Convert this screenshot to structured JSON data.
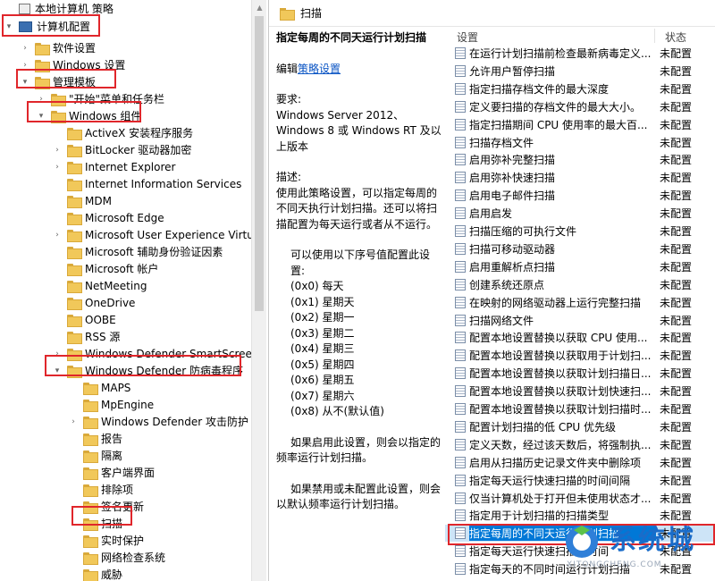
{
  "tree": {
    "nodes": [
      {
        "label": "本地计算机 策略",
        "toggle": "",
        "folder": false
      },
      {
        "label": "计算机配置",
        "toggle": "▾",
        "folder": false
      },
      {
        "label": "软件设置",
        "toggle": "›",
        "folder": true
      },
      {
        "label": "Windows 设置",
        "toggle": "›",
        "folder": true
      },
      {
        "label": "管理模板",
        "toggle": "▾",
        "folder": true
      },
      {
        "label": "\"开始\"菜单和任务栏",
        "toggle": "›",
        "folder": true
      },
      {
        "label": "Windows 组件",
        "toggle": "▾",
        "folder": true
      },
      {
        "label": "ActiveX 安装程序服务",
        "toggle": "",
        "folder": true
      },
      {
        "label": "BitLocker 驱动器加密",
        "toggle": "›",
        "folder": true
      },
      {
        "label": "Internet Explorer",
        "toggle": "›",
        "folder": true
      },
      {
        "label": "Internet Information Services",
        "toggle": "",
        "folder": true
      },
      {
        "label": "MDM",
        "toggle": "",
        "folder": true
      },
      {
        "label": "Microsoft Edge",
        "toggle": "",
        "folder": true
      },
      {
        "label": "Microsoft User Experience Virtuali",
        "toggle": "›",
        "folder": true
      },
      {
        "label": "Microsoft 辅助身份验证因素",
        "toggle": "",
        "folder": true
      },
      {
        "label": "Microsoft 帐户",
        "toggle": "",
        "folder": true
      },
      {
        "label": "NetMeeting",
        "toggle": "",
        "folder": true
      },
      {
        "label": "OneDrive",
        "toggle": "",
        "folder": true
      },
      {
        "label": "OOBE",
        "toggle": "",
        "folder": true
      },
      {
        "label": "RSS 源",
        "toggle": "",
        "folder": true
      },
      {
        "label": "Windows Defender SmartScreen",
        "toggle": "›",
        "folder": true
      },
      {
        "label": "Windows Defender 防病毒程序",
        "toggle": "▾",
        "folder": true
      },
      {
        "label": "MAPS",
        "toggle": "",
        "folder": true
      },
      {
        "label": "MpEngine",
        "toggle": "",
        "folder": true
      },
      {
        "label": "Windows Defender 攻击防护",
        "toggle": "›",
        "folder": true
      },
      {
        "label": "报告",
        "toggle": "",
        "folder": true
      },
      {
        "label": "隔离",
        "toggle": "",
        "folder": true
      },
      {
        "label": "客户端界面",
        "toggle": "",
        "folder": true
      },
      {
        "label": "排除项",
        "toggle": "",
        "folder": true
      },
      {
        "label": "签名更新",
        "toggle": "",
        "folder": true
      },
      {
        "label": "扫描",
        "toggle": "",
        "folder": true
      },
      {
        "label": "实时保护",
        "toggle": "",
        "folder": true
      },
      {
        "label": "网络检查系统",
        "toggle": "",
        "folder": true
      },
      {
        "label": "威胁",
        "toggle": "",
        "folder": true
      }
    ]
  },
  "right": {
    "title": "扫描",
    "desc": {
      "heading": "指定每周的不同天运行计划扫描",
      "edit_prefix": "编辑",
      "edit_link": "策略设置",
      "req_label": "要求:",
      "req_text": "Windows Server 2012、Windows 8 或 Windows RT 及以上版本",
      "desc_label": "描述:",
      "desc_text": "使用此策略设置，可以指定每周的不同天执行计划扫描。还可以将扫描配置为每天运行或者从不运行。",
      "values_intro": "可以使用以下序号值配置此设置:",
      "values": [
        "(0x0) 每天",
        "(0x1) 星期天",
        "(0x2) 星期一",
        "(0x3) 星期二",
        "(0x4) 星期三",
        "(0x5) 星期四",
        "(0x6) 星期五",
        "(0x7) 星期六",
        "(0x8) 从不(默认值)"
      ],
      "enabled_text": "如果启用此设置，则会以指定的频率运行计划扫描。",
      "disabled_text": "如果禁用或未配置此设置，则会以默认频率运行计划扫描。"
    },
    "columns": {
      "setting": "设置",
      "state": "状态"
    },
    "rows": [
      {
        "name": "在运行计划扫描前检查最新病毒定义...",
        "state": "未配置"
      },
      {
        "name": "允许用户暂停扫描",
        "state": "未配置"
      },
      {
        "name": "指定扫描存档文件的最大深度",
        "state": "未配置"
      },
      {
        "name": "定义要扫描的存档文件的最大大小。",
        "state": "未配置"
      },
      {
        "name": "指定扫描期间 CPU 使用率的最大百...",
        "state": "未配置"
      },
      {
        "name": "扫描存档文件",
        "state": "未配置"
      },
      {
        "name": "启用弥补完整扫描",
        "state": "未配置"
      },
      {
        "name": "启用弥补快速扫描",
        "state": "未配置"
      },
      {
        "name": "启用电子邮件扫描",
        "state": "未配置"
      },
      {
        "name": "启用启发",
        "state": "未配置"
      },
      {
        "name": "扫描压缩的可执行文件",
        "state": "未配置"
      },
      {
        "name": "扫描可移动驱动器",
        "state": "未配置"
      },
      {
        "name": "启用重解析点扫描",
        "state": "未配置"
      },
      {
        "name": "创建系统还原点",
        "state": "未配置"
      },
      {
        "name": "在映射的网络驱动器上运行完整扫描",
        "state": "未配置"
      },
      {
        "name": "扫描网络文件",
        "state": "未配置"
      },
      {
        "name": "配置本地设置替换以获取 CPU 使用...",
        "state": "未配置"
      },
      {
        "name": "配置本地设置替换以获取用于计划扫...",
        "state": "未配置"
      },
      {
        "name": "配置本地设置替换以获取计划扫描日...",
        "state": "未配置"
      },
      {
        "name": "配置本地设置替换以获取计划快速扫...",
        "state": "未配置"
      },
      {
        "name": "配置本地设置替换以获取计划扫描时...",
        "state": "未配置"
      },
      {
        "name": "配置计划扫描的低 CPU 优先级",
        "state": "未配置"
      },
      {
        "name": "定义天数，经过该天数后，将强制执...",
        "state": "未配置"
      },
      {
        "name": "启用从扫描历史记录文件夹中删除项",
        "state": "未配置"
      },
      {
        "name": "指定每天运行快速扫描的时间间隔",
        "state": "未配置"
      },
      {
        "name": "仅当计算机处于打开但未使用状态才...",
        "state": "未配置"
      },
      {
        "name": "指定用于计划扫描的扫描类型",
        "state": "未配置"
      },
      {
        "name": "指定每周的不同天运行计划扫描",
        "state": "未配置"
      },
      {
        "name": "指定每天运行快速扫描的时间",
        "state": "未配置"
      },
      {
        "name": "指定每天的不同时间运行计划扫描",
        "state": "未配置"
      }
    ],
    "selected_index": 27
  },
  "watermark": {
    "text": "系统城",
    "url": "XITONGCHENG.COM"
  },
  "colors": {
    "highlight": "#e0262b",
    "selection": "#0078d7",
    "link": "#0b55c4"
  }
}
